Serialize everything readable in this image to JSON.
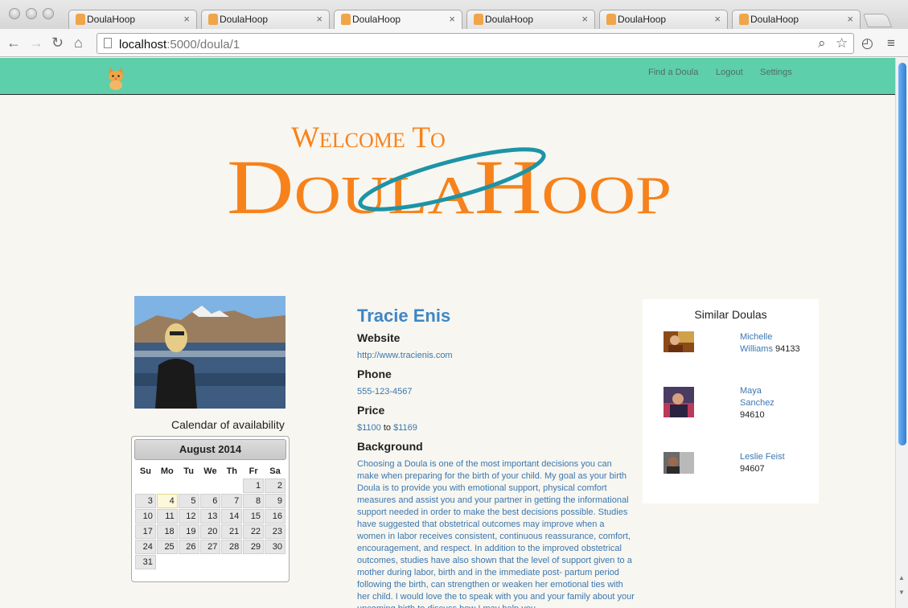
{
  "browser": {
    "tabs": [
      {
        "title": "DoulaHoop",
        "active": false
      },
      {
        "title": "DoulaHoop",
        "active": false
      },
      {
        "title": "DoulaHoop",
        "active": true
      },
      {
        "title": "DoulaHoop",
        "active": false
      },
      {
        "title": "DoulaHoop",
        "active": false
      },
      {
        "title": "DoulaHoop",
        "active": false
      }
    ],
    "tab_close": "×",
    "url_host": "localhost",
    "url_path": ":5000/doula/1"
  },
  "navbar": {
    "links": [
      "Find a Doula",
      "Logout",
      "Settings"
    ],
    "color": "#5dcfab"
  },
  "hero": {
    "line1": "Welcome To",
    "brand": "DoulaHoop",
    "text_color": "#f7821b",
    "ring_color": "#1d93a6"
  },
  "calendar": {
    "heading": "Calendar of availability",
    "month_label": "August 2014",
    "weekdays": [
      "Su",
      "Mo",
      "Tu",
      "We",
      "Th",
      "Fr",
      "Sa"
    ],
    "weeks": [
      [
        "",
        "",
        "",
        "",
        "",
        "1",
        "2"
      ],
      [
        "3",
        "4",
        "5",
        "6",
        "7",
        "8",
        "9"
      ],
      [
        "10",
        "11",
        "12",
        "13",
        "14",
        "15",
        "16"
      ],
      [
        "17",
        "18",
        "19",
        "20",
        "21",
        "22",
        "23"
      ],
      [
        "24",
        "25",
        "26",
        "27",
        "28",
        "29",
        "30"
      ],
      [
        "31",
        "",
        "",
        "",
        "",
        "",
        ""
      ]
    ],
    "today": "4"
  },
  "profile": {
    "name": "Tracie Enis",
    "website_label": "Website",
    "website": "http://www.tracienis.com",
    "phone_label": "Phone",
    "phone": "555-123-4567",
    "price_label": "Price",
    "price_min": "$1100",
    "price_to": "to",
    "price_max": "$1169",
    "background_label": "Background",
    "background": "Choosing a Doula is one of the most important decisions you can make when preparing for the birth of your child. My goal as your birth Doula is to provide you with emotional support, physical comfort measures and assist you and your partner in getting the informational support needed in order to make the best decisions possible. Studies have suggested that obstetrical outcomes may improve when a women in labor receives consistent, continuous reassurance, comfort, encouragement, and respect. In addition to the improved obstetrical outcomes, studies have also shown that the level of support given to a mother during labor, birth and in the immediate post- partum period following the birth, can strengthen or weaken her emotional ties with her child. I would love the to speak with you and your family about your upcoming birth to discuss how I may help you"
  },
  "similar": {
    "heading": "Similar Doulas",
    "items": [
      {
        "name_line1": "Michelle",
        "name_line2": "Williams",
        "zip": "94133"
      },
      {
        "name_line1": "Maya",
        "name_line2": "Sanchez",
        "zip": "94610"
      },
      {
        "name_line1": "Leslie Feist",
        "name_line2": "",
        "zip": "94607"
      }
    ]
  }
}
